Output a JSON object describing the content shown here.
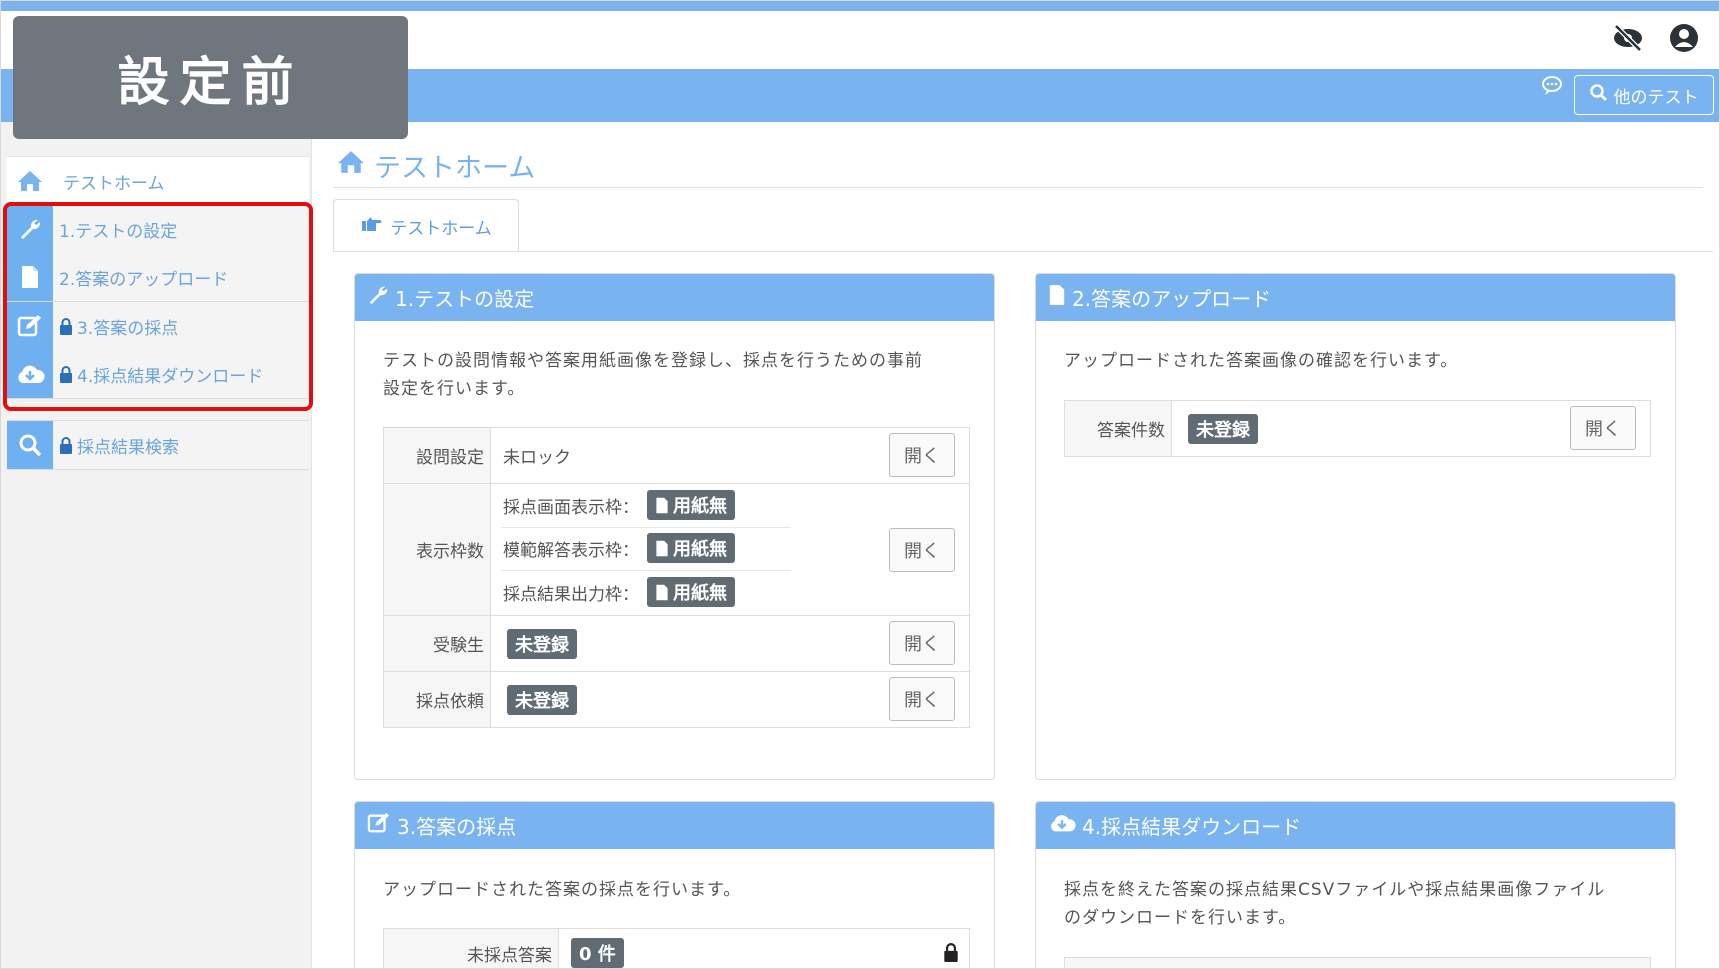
{
  "overlay_label": "設定前",
  "header": {
    "other_test_label": "他のテスト",
    "icons": [
      "eye-slash-icon",
      "user-circle-icon",
      "chat-icon",
      "search-icon"
    ]
  },
  "sidebar": {
    "home_label": "テストホーム",
    "items": [
      {
        "label": "1.テストの設定",
        "icon": "wrench-icon",
        "locked": false
      },
      {
        "label": "2.答案のアップロード",
        "icon": "file-icon",
        "locked": false
      },
      {
        "label": "3.答案の採点",
        "icon": "edit-icon",
        "locked": true
      },
      {
        "label": "4.採点結果ダウンロード",
        "icon": "cloud-download-icon",
        "locked": true
      }
    ],
    "search_item": {
      "label": "採点結果検索",
      "icon": "search-icon",
      "locked": true
    }
  },
  "main": {
    "title": "テストホーム",
    "tab_label": "テストホーム"
  },
  "panels": {
    "settings": {
      "title": "1.テストの設定",
      "desc_line1": "テストの設問情報や答案用紙画像を登録し、採点を行うための事前",
      "desc_line2": "設定を行います。",
      "rows": {
        "questions_label": "設問設定",
        "questions_value": "未ロック",
        "frames_label": "表示枠数",
        "frame1_label": "採点画面表示枠：",
        "frame2_label": "模範解答表示枠：",
        "frame3_label": "採点結果出力枠：",
        "frame_badge": "用紙無",
        "examinees_label": "受験生",
        "examinees_badge": "未登録",
        "request_label": "採点依頼",
        "request_badge": "未登録",
        "open_label": "開く"
      }
    },
    "upload": {
      "title": "2.答案のアップロード",
      "desc": "アップロードされた答案画像の確認を行います。",
      "count_label": "答案件数",
      "count_badge": "未登録",
      "open_label": "開く"
    },
    "grading": {
      "title": "3.答案の採点",
      "desc": "アップロードされた答案の採点を行います。",
      "ungraded_label": "未採点答案",
      "ungraded_badge": "0 件"
    },
    "download": {
      "title": "4.採点結果ダウンロード",
      "desc_line1": "採点を終えた答案の採点結果CSVファイルや採点結果画像ファイル",
      "desc_line2": "のダウンロードを行います。"
    }
  },
  "colors": {
    "accent": "#79b3f0",
    "badge": "#616b74",
    "highlight_border": "#e20d0d",
    "overlay": "#6f767d"
  }
}
